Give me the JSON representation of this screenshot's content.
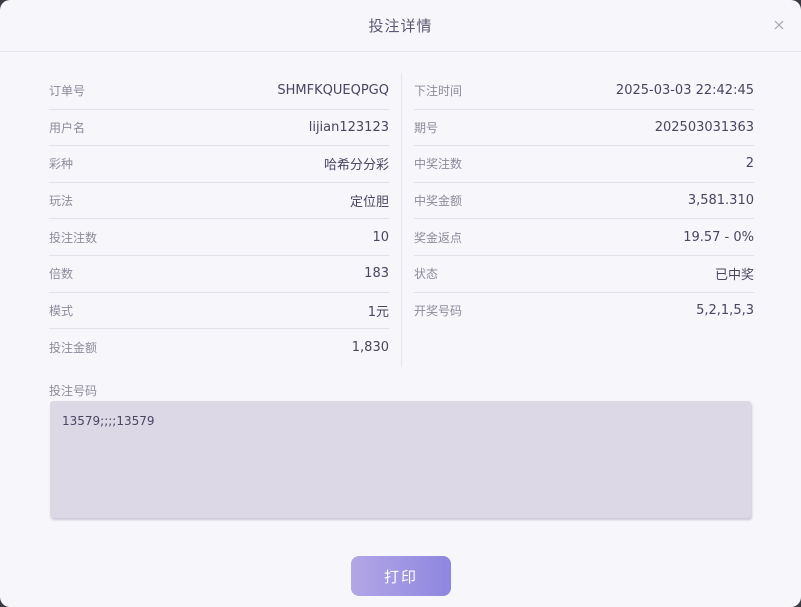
{
  "modal": {
    "title": "投注详情"
  },
  "details_left": [
    {
      "label": "订单号",
      "value": "SHMFKQUEQPGQ"
    },
    {
      "label": "用户名",
      "value": "lijian123123"
    },
    {
      "label": "彩种",
      "value": "哈希分分彩"
    },
    {
      "label": "玩法",
      "value": "定位胆"
    },
    {
      "label": "投注注数",
      "value": "10"
    },
    {
      "label": "倍数",
      "value": "183"
    },
    {
      "label": "模式",
      "value": "1元"
    },
    {
      "label": "投注金额",
      "value": "1,830"
    }
  ],
  "details_right": [
    {
      "label": "下注时间",
      "value": "2025-03-03 22:42:45"
    },
    {
      "label": "期号",
      "value": "202503031363"
    },
    {
      "label": "中奖注数",
      "value": "2"
    },
    {
      "label": "中奖金额",
      "value": "3,581.310"
    },
    {
      "label": "奖金返点",
      "value": "19.57 - 0%"
    },
    {
      "label": "状态",
      "value": "已中奖"
    },
    {
      "label": "开奖号码",
      "value": "5,2,1,5,3"
    }
  ],
  "bet_numbers": {
    "label": "投注号码",
    "value": "13579;;;;13579"
  },
  "actions": {
    "print_label": "打印"
  },
  "colors": {
    "accent_gradient_start": "#b3a7e6",
    "accent_gradient_end": "#8e86e0",
    "box_background": "#dcd8e6"
  }
}
